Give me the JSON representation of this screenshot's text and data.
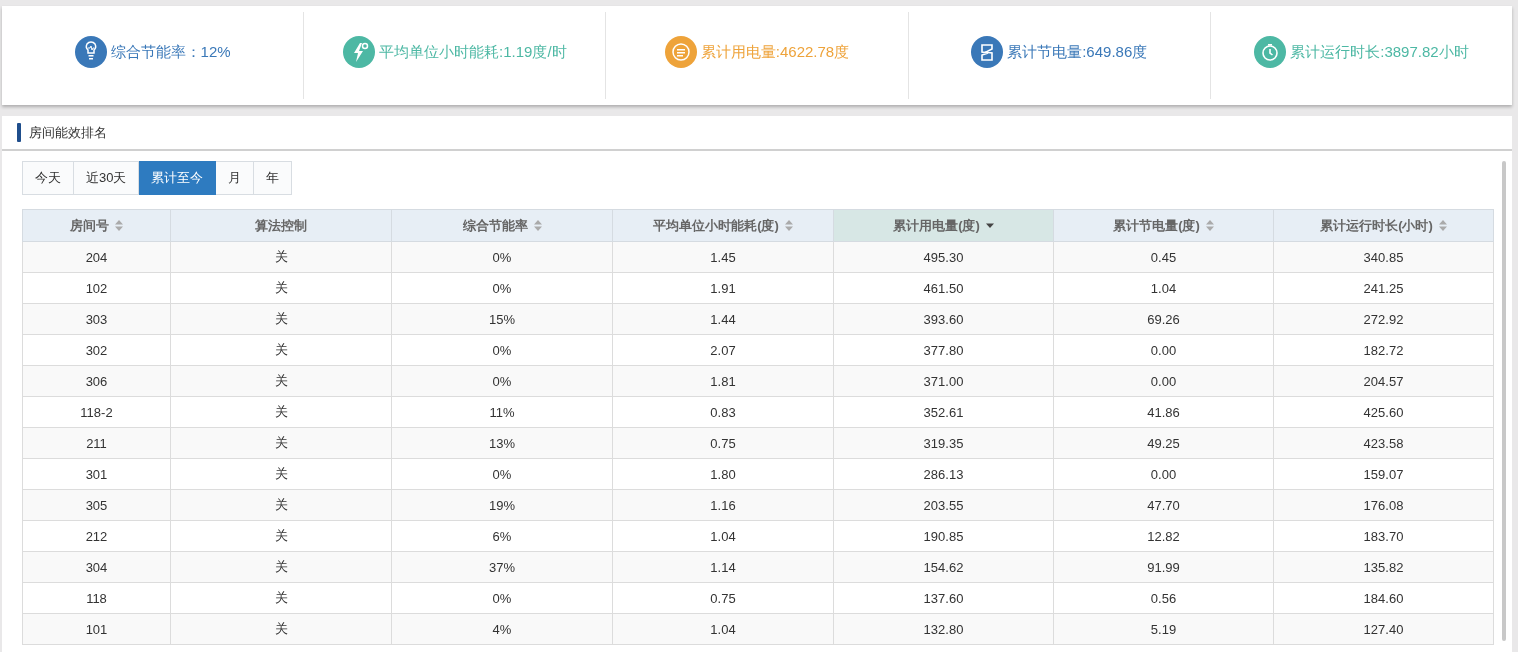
{
  "stats": [
    {
      "kind": "bulb",
      "label": "综合节能率：12%",
      "color": "#3a78b8"
    },
    {
      "kind": "bolt",
      "label": "平均单位小时能耗:1.19度/时",
      "color": "#4db8a4"
    },
    {
      "kind": "meter",
      "label": "累计用电量:4622.78度",
      "color": "#eea33a"
    },
    {
      "kind": "save",
      "label": "累计节电量:649.86度",
      "color": "#3a78b8"
    },
    {
      "kind": "clock",
      "label": "累计运行时长:3897.82小时",
      "color": "#4db8a4"
    }
  ],
  "panel": {
    "title": "房间能效排名",
    "tabs": [
      {
        "label": "今天",
        "selected": false
      },
      {
        "label": "近30天",
        "selected": false
      },
      {
        "label": "累计至今",
        "selected": true
      },
      {
        "label": "月",
        "selected": false
      },
      {
        "label": "年",
        "selected": false
      }
    ],
    "table": {
      "columns": [
        {
          "label": "房间号",
          "kind": "sortable",
          "selected": false
        },
        {
          "label": "算法控制",
          "kind": "plain",
          "selected": false
        },
        {
          "label": "综合节能率",
          "kind": "sortable",
          "selected": false
        },
        {
          "label": "平均单位小时能耗(度)",
          "kind": "sortable",
          "selected": false
        },
        {
          "label": "累计用电量(度)",
          "kind": "descending",
          "selected": true
        },
        {
          "label": "累计节电量(度)",
          "kind": "sortable",
          "selected": false
        },
        {
          "label": "累计运行时长(小时)",
          "kind": "sortable",
          "selected": false
        }
      ],
      "rows": [
        [
          "204",
          "关",
          "0%",
          "1.45",
          "495.30",
          "0.45",
          "340.85"
        ],
        [
          "102",
          "关",
          "0%",
          "1.91",
          "461.50",
          "1.04",
          "241.25"
        ],
        [
          "303",
          "关",
          "15%",
          "1.44",
          "393.60",
          "69.26",
          "272.92"
        ],
        [
          "302",
          "关",
          "0%",
          "2.07",
          "377.80",
          "0.00",
          "182.72"
        ],
        [
          "306",
          "关",
          "0%",
          "1.81",
          "371.00",
          "0.00",
          "204.57"
        ],
        [
          "118-2",
          "关",
          "11%",
          "0.83",
          "352.61",
          "41.86",
          "425.60"
        ],
        [
          "211",
          "关",
          "13%",
          "0.75",
          "319.35",
          "49.25",
          "423.58"
        ],
        [
          "301",
          "关",
          "0%",
          "1.80",
          "286.13",
          "0.00",
          "159.07"
        ],
        [
          "305",
          "关",
          "19%",
          "1.16",
          "203.55",
          "47.70",
          "176.08"
        ],
        [
          "212",
          "关",
          "6%",
          "1.04",
          "190.85",
          "12.82",
          "183.70"
        ],
        [
          "304",
          "关",
          "37%",
          "1.14",
          "154.62",
          "91.99",
          "135.82"
        ],
        [
          "118",
          "关",
          "0%",
          "0.75",
          "137.60",
          "0.56",
          "184.60"
        ],
        [
          "101",
          "关",
          "4%",
          "1.04",
          "132.80",
          "5.19",
          "127.40"
        ]
      ]
    }
  }
}
